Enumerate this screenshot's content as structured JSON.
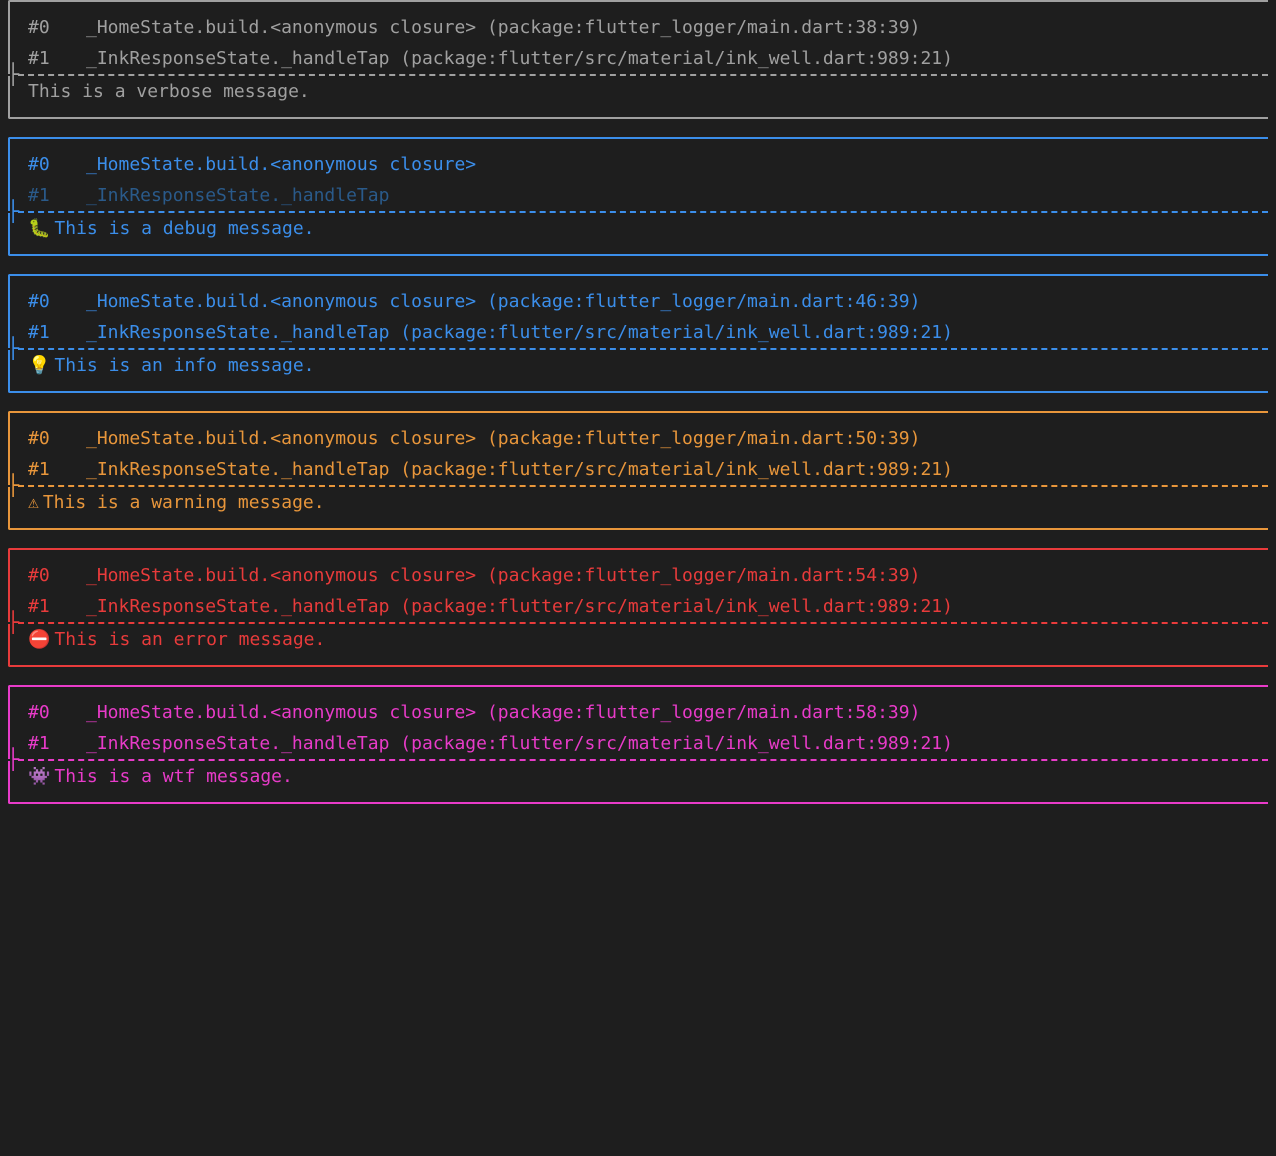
{
  "logs": [
    {
      "level": "verbose",
      "stack": [
        {
          "num": "#0",
          "text": "_HomeState.build.<anonymous closure> (package:flutter_logger/main.dart:38:39)"
        },
        {
          "num": "#1",
          "text": "_InkResponseState._handleTap (package:flutter/src/material/ink_well.dart:989:21)"
        }
      ],
      "icon": "",
      "message": "This is a verbose message."
    },
    {
      "level": "debug",
      "stack": [
        {
          "num": "#0",
          "text": "_HomeState.build.<anonymous closure>",
          "faded": false
        },
        {
          "num": "#1",
          "text": "_InkResponseState._handleTap",
          "faded": true
        }
      ],
      "icon": "🐛",
      "message": "This is a debug message."
    },
    {
      "level": "info",
      "stack": [
        {
          "num": "#0",
          "text": "_HomeState.build.<anonymous closure> (package:flutter_logger/main.dart:46:39)"
        },
        {
          "num": "#1",
          "text": "_InkResponseState._handleTap (package:flutter/src/material/ink_well.dart:989:21)"
        }
      ],
      "icon": "💡",
      "message": "This is an info message."
    },
    {
      "level": "warning",
      "stack": [
        {
          "num": "#0",
          "text": "_HomeState.build.<anonymous closure> (package:flutter_logger/main.dart:50:39)"
        },
        {
          "num": "#1",
          "text": "_InkResponseState._handleTap (package:flutter/src/material/ink_well.dart:989:21)"
        }
      ],
      "icon": "⚠",
      "message": "This is a warning message."
    },
    {
      "level": "error",
      "stack": [
        {
          "num": "#0",
          "text": "_HomeState.build.<anonymous closure> (package:flutter_logger/main.dart:54:39)"
        },
        {
          "num": "#1",
          "text": "_InkResponseState._handleTap (package:flutter/src/material/ink_well.dart:989:21)"
        }
      ],
      "icon": "⛔",
      "message": "This is an error message."
    },
    {
      "level": "wtf",
      "stack": [
        {
          "num": "#0",
          "text": "_HomeState.build.<anonymous closure> (package:flutter_logger/main.dart:58:39)"
        },
        {
          "num": "#1",
          "text": "_InkResponseState._handleTap (package:flutter/src/material/ink_well.dart:989:21)"
        }
      ],
      "icon": "👾",
      "message": "This is a wtf message."
    }
  ]
}
